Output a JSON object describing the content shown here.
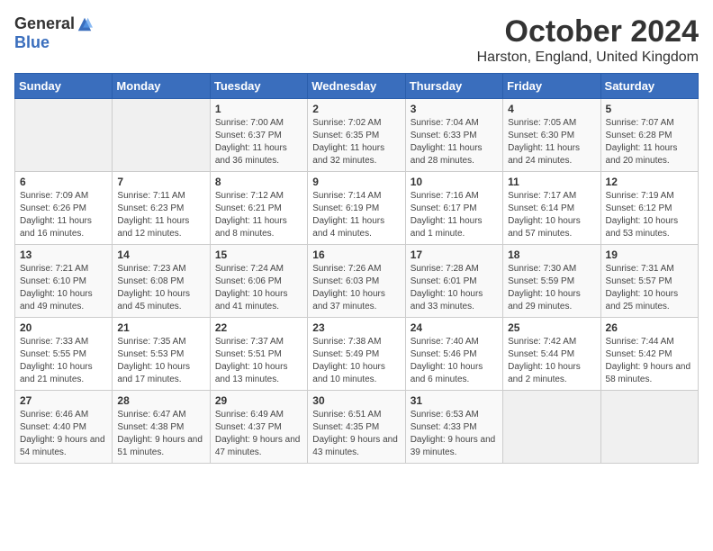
{
  "header": {
    "logo_general": "General",
    "logo_blue": "Blue",
    "month_title": "October 2024",
    "location": "Harston, England, United Kingdom"
  },
  "days_of_week": [
    "Sunday",
    "Monday",
    "Tuesday",
    "Wednesday",
    "Thursday",
    "Friday",
    "Saturday"
  ],
  "weeks": [
    [
      {
        "day": "",
        "info": ""
      },
      {
        "day": "",
        "info": ""
      },
      {
        "day": "1",
        "info": "Sunrise: 7:00 AM\nSunset: 6:37 PM\nDaylight: 11 hours and 36 minutes."
      },
      {
        "day": "2",
        "info": "Sunrise: 7:02 AM\nSunset: 6:35 PM\nDaylight: 11 hours and 32 minutes."
      },
      {
        "day": "3",
        "info": "Sunrise: 7:04 AM\nSunset: 6:33 PM\nDaylight: 11 hours and 28 minutes."
      },
      {
        "day": "4",
        "info": "Sunrise: 7:05 AM\nSunset: 6:30 PM\nDaylight: 11 hours and 24 minutes."
      },
      {
        "day": "5",
        "info": "Sunrise: 7:07 AM\nSunset: 6:28 PM\nDaylight: 11 hours and 20 minutes."
      }
    ],
    [
      {
        "day": "6",
        "info": "Sunrise: 7:09 AM\nSunset: 6:26 PM\nDaylight: 11 hours and 16 minutes."
      },
      {
        "day": "7",
        "info": "Sunrise: 7:11 AM\nSunset: 6:23 PM\nDaylight: 11 hours and 12 minutes."
      },
      {
        "day": "8",
        "info": "Sunrise: 7:12 AM\nSunset: 6:21 PM\nDaylight: 11 hours and 8 minutes."
      },
      {
        "day": "9",
        "info": "Sunrise: 7:14 AM\nSunset: 6:19 PM\nDaylight: 11 hours and 4 minutes."
      },
      {
        "day": "10",
        "info": "Sunrise: 7:16 AM\nSunset: 6:17 PM\nDaylight: 11 hours and 1 minute."
      },
      {
        "day": "11",
        "info": "Sunrise: 7:17 AM\nSunset: 6:14 PM\nDaylight: 10 hours and 57 minutes."
      },
      {
        "day": "12",
        "info": "Sunrise: 7:19 AM\nSunset: 6:12 PM\nDaylight: 10 hours and 53 minutes."
      }
    ],
    [
      {
        "day": "13",
        "info": "Sunrise: 7:21 AM\nSunset: 6:10 PM\nDaylight: 10 hours and 49 minutes."
      },
      {
        "day": "14",
        "info": "Sunrise: 7:23 AM\nSunset: 6:08 PM\nDaylight: 10 hours and 45 minutes."
      },
      {
        "day": "15",
        "info": "Sunrise: 7:24 AM\nSunset: 6:06 PM\nDaylight: 10 hours and 41 minutes."
      },
      {
        "day": "16",
        "info": "Sunrise: 7:26 AM\nSunset: 6:03 PM\nDaylight: 10 hours and 37 minutes."
      },
      {
        "day": "17",
        "info": "Sunrise: 7:28 AM\nSunset: 6:01 PM\nDaylight: 10 hours and 33 minutes."
      },
      {
        "day": "18",
        "info": "Sunrise: 7:30 AM\nSunset: 5:59 PM\nDaylight: 10 hours and 29 minutes."
      },
      {
        "day": "19",
        "info": "Sunrise: 7:31 AM\nSunset: 5:57 PM\nDaylight: 10 hours and 25 minutes."
      }
    ],
    [
      {
        "day": "20",
        "info": "Sunrise: 7:33 AM\nSunset: 5:55 PM\nDaylight: 10 hours and 21 minutes."
      },
      {
        "day": "21",
        "info": "Sunrise: 7:35 AM\nSunset: 5:53 PM\nDaylight: 10 hours and 17 minutes."
      },
      {
        "day": "22",
        "info": "Sunrise: 7:37 AM\nSunset: 5:51 PM\nDaylight: 10 hours and 13 minutes."
      },
      {
        "day": "23",
        "info": "Sunrise: 7:38 AM\nSunset: 5:49 PM\nDaylight: 10 hours and 10 minutes."
      },
      {
        "day": "24",
        "info": "Sunrise: 7:40 AM\nSunset: 5:46 PM\nDaylight: 10 hours and 6 minutes."
      },
      {
        "day": "25",
        "info": "Sunrise: 7:42 AM\nSunset: 5:44 PM\nDaylight: 10 hours and 2 minutes."
      },
      {
        "day": "26",
        "info": "Sunrise: 7:44 AM\nSunset: 5:42 PM\nDaylight: 9 hours and 58 minutes."
      }
    ],
    [
      {
        "day": "27",
        "info": "Sunrise: 6:46 AM\nSunset: 4:40 PM\nDaylight: 9 hours and 54 minutes."
      },
      {
        "day": "28",
        "info": "Sunrise: 6:47 AM\nSunset: 4:38 PM\nDaylight: 9 hours and 51 minutes."
      },
      {
        "day": "29",
        "info": "Sunrise: 6:49 AM\nSunset: 4:37 PM\nDaylight: 9 hours and 47 minutes."
      },
      {
        "day": "30",
        "info": "Sunrise: 6:51 AM\nSunset: 4:35 PM\nDaylight: 9 hours and 43 minutes."
      },
      {
        "day": "31",
        "info": "Sunrise: 6:53 AM\nSunset: 4:33 PM\nDaylight: 9 hours and 39 minutes."
      },
      {
        "day": "",
        "info": ""
      },
      {
        "day": "",
        "info": ""
      }
    ]
  ]
}
